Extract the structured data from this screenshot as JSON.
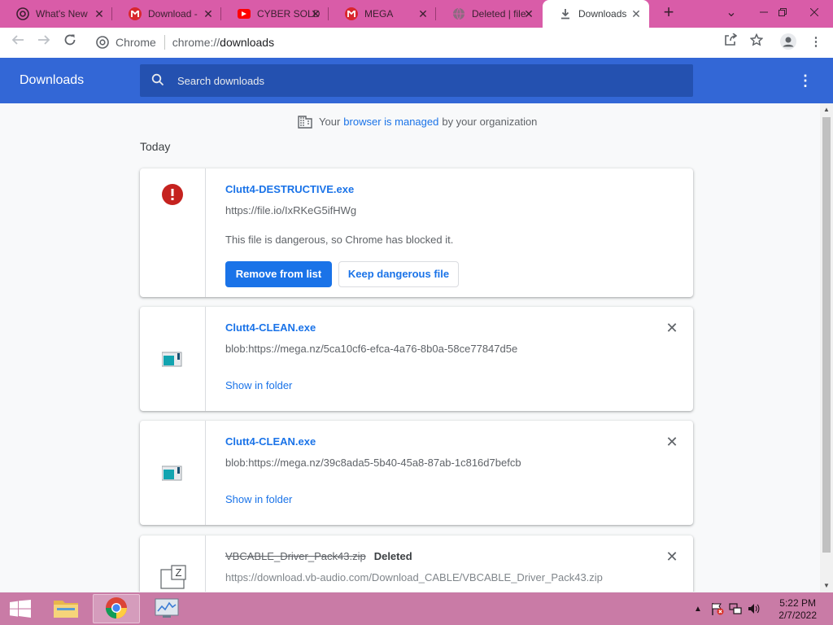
{
  "tabs": [
    {
      "title": "What's New",
      "favicon": "chrome-icon",
      "active": false
    },
    {
      "title": "Download -",
      "favicon": "mega-icon",
      "active": false
    },
    {
      "title": "CYBER SOLD",
      "favicon": "youtube-icon",
      "active": false
    },
    {
      "title": "MEGA",
      "favicon": "mega-icon",
      "active": false
    },
    {
      "title": "Deleted | file",
      "favicon": "globe-icon",
      "active": false
    },
    {
      "title": "Downloads",
      "favicon": "download-icon",
      "active": true
    }
  ],
  "window_controls": {
    "minimize": "—",
    "restore": "❐",
    "close": "✕",
    "tab_search": "⌄"
  },
  "toolbar": {
    "site_chip": "Chrome",
    "url_scheme": "chrome://",
    "url_path": "downloads"
  },
  "header": {
    "title": "Downloads",
    "search_placeholder": "Search downloads"
  },
  "managed_notice": {
    "prefix": "Your",
    "link": "browser is managed",
    "suffix": "by your organization"
  },
  "section": {
    "label": "Today"
  },
  "downloads": [
    {
      "name": "Clutt4-DESTRUCTIVE.exe",
      "url": "https://file.io/IxRKeG5ifHWg",
      "message": "This file is dangerous, so Chrome has blocked it.",
      "primary_action": "Remove from list",
      "secondary_action": "Keep dangerous file",
      "status": "dangerous"
    },
    {
      "name": "Clutt4-CLEAN.exe",
      "url": "blob:https://mega.nz/5ca10cf6-efca-4a76-8b0a-58ce77847d5e",
      "action": "Show in folder",
      "status": "complete"
    },
    {
      "name": "Clutt4-CLEAN.exe",
      "url": "blob:https://mega.nz/39c8ada5-5b40-45a8-87ab-1c816d7befcb",
      "action": "Show in folder",
      "status": "complete"
    },
    {
      "name": "VBCABLE_Driver_Pack43.zip",
      "status_label": "Deleted",
      "url": "https://download.vb-audio.com/Download_CABLE/VBCABLE_Driver_Pack43.zip",
      "status": "deleted"
    }
  ],
  "taskbar": {
    "apps": [
      "file-explorer-icon",
      "chrome-icon",
      "task-manager-icon"
    ],
    "time": "5:22 PM",
    "date": "2/7/2022"
  },
  "colors": {
    "tabstrip": "#d95ca8",
    "header_blue": "#3367d6",
    "link_blue": "#1a73e8",
    "danger_red": "#c5221f",
    "taskbar": "#c97ba6"
  }
}
